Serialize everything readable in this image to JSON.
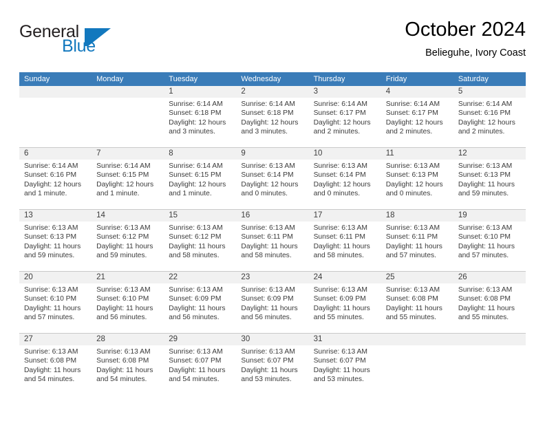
{
  "brand": {
    "name_top": "General",
    "name_bottom": "Blue",
    "color_primary": "#1278be",
    "color_text": "#231f20"
  },
  "header": {
    "title": "October 2024",
    "subtitle": "Belieguhe, Ivory Coast"
  },
  "calendar": {
    "header_bg": "#3a7cb8",
    "header_text_color": "#ffffff",
    "weekdays": [
      "Sunday",
      "Monday",
      "Tuesday",
      "Wednesday",
      "Thursday",
      "Friday",
      "Saturday"
    ],
    "weeks": [
      [
        {
          "day": "",
          "lines": []
        },
        {
          "day": "",
          "lines": []
        },
        {
          "day": "1",
          "lines": [
            "Sunrise: 6:14 AM",
            "Sunset: 6:18 PM",
            "Daylight: 12 hours",
            "and 3 minutes."
          ]
        },
        {
          "day": "2",
          "lines": [
            "Sunrise: 6:14 AM",
            "Sunset: 6:18 PM",
            "Daylight: 12 hours",
            "and 3 minutes."
          ]
        },
        {
          "day": "3",
          "lines": [
            "Sunrise: 6:14 AM",
            "Sunset: 6:17 PM",
            "Daylight: 12 hours",
            "and 2 minutes."
          ]
        },
        {
          "day": "4",
          "lines": [
            "Sunrise: 6:14 AM",
            "Sunset: 6:17 PM",
            "Daylight: 12 hours",
            "and 2 minutes."
          ]
        },
        {
          "day": "5",
          "lines": [
            "Sunrise: 6:14 AM",
            "Sunset: 6:16 PM",
            "Daylight: 12 hours",
            "and 2 minutes."
          ]
        }
      ],
      [
        {
          "day": "6",
          "lines": [
            "Sunrise: 6:14 AM",
            "Sunset: 6:16 PM",
            "Daylight: 12 hours",
            "and 1 minute."
          ]
        },
        {
          "day": "7",
          "lines": [
            "Sunrise: 6:14 AM",
            "Sunset: 6:15 PM",
            "Daylight: 12 hours",
            "and 1 minute."
          ]
        },
        {
          "day": "8",
          "lines": [
            "Sunrise: 6:14 AM",
            "Sunset: 6:15 PM",
            "Daylight: 12 hours",
            "and 1 minute."
          ]
        },
        {
          "day": "9",
          "lines": [
            "Sunrise: 6:13 AM",
            "Sunset: 6:14 PM",
            "Daylight: 12 hours",
            "and 0 minutes."
          ]
        },
        {
          "day": "10",
          "lines": [
            "Sunrise: 6:13 AM",
            "Sunset: 6:14 PM",
            "Daylight: 12 hours",
            "and 0 minutes."
          ]
        },
        {
          "day": "11",
          "lines": [
            "Sunrise: 6:13 AM",
            "Sunset: 6:13 PM",
            "Daylight: 12 hours",
            "and 0 minutes."
          ]
        },
        {
          "day": "12",
          "lines": [
            "Sunrise: 6:13 AM",
            "Sunset: 6:13 PM",
            "Daylight: 11 hours",
            "and 59 minutes."
          ]
        }
      ],
      [
        {
          "day": "13",
          "lines": [
            "Sunrise: 6:13 AM",
            "Sunset: 6:13 PM",
            "Daylight: 11 hours",
            "and 59 minutes."
          ]
        },
        {
          "day": "14",
          "lines": [
            "Sunrise: 6:13 AM",
            "Sunset: 6:12 PM",
            "Daylight: 11 hours",
            "and 59 minutes."
          ]
        },
        {
          "day": "15",
          "lines": [
            "Sunrise: 6:13 AM",
            "Sunset: 6:12 PM",
            "Daylight: 11 hours",
            "and 58 minutes."
          ]
        },
        {
          "day": "16",
          "lines": [
            "Sunrise: 6:13 AM",
            "Sunset: 6:11 PM",
            "Daylight: 11 hours",
            "and 58 minutes."
          ]
        },
        {
          "day": "17",
          "lines": [
            "Sunrise: 6:13 AM",
            "Sunset: 6:11 PM",
            "Daylight: 11 hours",
            "and 58 minutes."
          ]
        },
        {
          "day": "18",
          "lines": [
            "Sunrise: 6:13 AM",
            "Sunset: 6:11 PM",
            "Daylight: 11 hours",
            "and 57 minutes."
          ]
        },
        {
          "day": "19",
          "lines": [
            "Sunrise: 6:13 AM",
            "Sunset: 6:10 PM",
            "Daylight: 11 hours",
            "and 57 minutes."
          ]
        }
      ],
      [
        {
          "day": "20",
          "lines": [
            "Sunrise: 6:13 AM",
            "Sunset: 6:10 PM",
            "Daylight: 11 hours",
            "and 57 minutes."
          ]
        },
        {
          "day": "21",
          "lines": [
            "Sunrise: 6:13 AM",
            "Sunset: 6:10 PM",
            "Daylight: 11 hours",
            "and 56 minutes."
          ]
        },
        {
          "day": "22",
          "lines": [
            "Sunrise: 6:13 AM",
            "Sunset: 6:09 PM",
            "Daylight: 11 hours",
            "and 56 minutes."
          ]
        },
        {
          "day": "23",
          "lines": [
            "Sunrise: 6:13 AM",
            "Sunset: 6:09 PM",
            "Daylight: 11 hours",
            "and 56 minutes."
          ]
        },
        {
          "day": "24",
          "lines": [
            "Sunrise: 6:13 AM",
            "Sunset: 6:09 PM",
            "Daylight: 11 hours",
            "and 55 minutes."
          ]
        },
        {
          "day": "25",
          "lines": [
            "Sunrise: 6:13 AM",
            "Sunset: 6:08 PM",
            "Daylight: 11 hours",
            "and 55 minutes."
          ]
        },
        {
          "day": "26",
          "lines": [
            "Sunrise: 6:13 AM",
            "Sunset: 6:08 PM",
            "Daylight: 11 hours",
            "and 55 minutes."
          ]
        }
      ],
      [
        {
          "day": "27",
          "lines": [
            "Sunrise: 6:13 AM",
            "Sunset: 6:08 PM",
            "Daylight: 11 hours",
            "and 54 minutes."
          ]
        },
        {
          "day": "28",
          "lines": [
            "Sunrise: 6:13 AM",
            "Sunset: 6:08 PM",
            "Daylight: 11 hours",
            "and 54 minutes."
          ]
        },
        {
          "day": "29",
          "lines": [
            "Sunrise: 6:13 AM",
            "Sunset: 6:07 PM",
            "Daylight: 11 hours",
            "and 54 minutes."
          ]
        },
        {
          "day": "30",
          "lines": [
            "Sunrise: 6:13 AM",
            "Sunset: 6:07 PM",
            "Daylight: 11 hours",
            "and 53 minutes."
          ]
        },
        {
          "day": "31",
          "lines": [
            "Sunrise: 6:13 AM",
            "Sunset: 6:07 PM",
            "Daylight: 11 hours",
            "and 53 minutes."
          ]
        },
        {
          "day": "",
          "lines": []
        },
        {
          "day": "",
          "lines": []
        }
      ]
    ]
  }
}
